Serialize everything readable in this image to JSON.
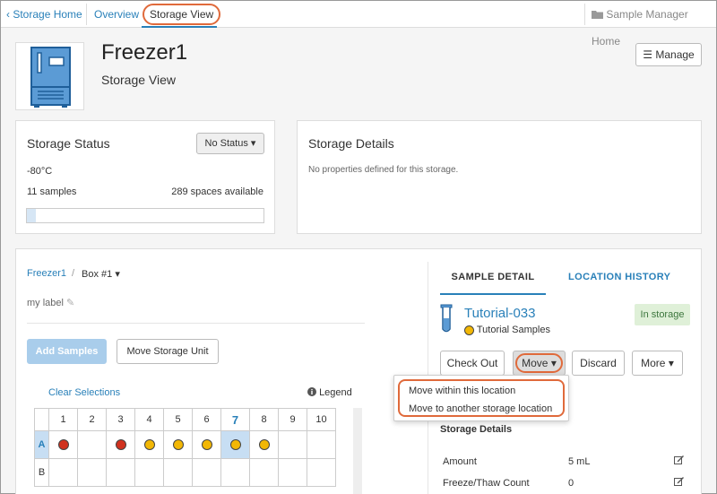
{
  "nav": {
    "home": "Storage Home",
    "overview": "Overview",
    "storage_view": "Storage View",
    "sample_manager_home": "Sample Manager Home"
  },
  "header": {
    "title": "Freezer1",
    "subtitle": "Storage View",
    "manage_label": "Manage"
  },
  "status_panel": {
    "title": "Storage Status",
    "status_button": "No Status",
    "temperature": "-80°C",
    "samples": "11 samples",
    "spaces": "289 spaces available",
    "fill_fraction": 0.037
  },
  "details_panel": {
    "title": "Storage Details",
    "empty_text": "No properties defined for this storage."
  },
  "grid": {
    "breadcrumb_root": "Freezer1",
    "breadcrumb_sep": "/",
    "breadcrumb_box": "Box #1",
    "label_text": "my label",
    "add_samples": "Add Samples",
    "move_unit": "Move Storage Unit",
    "clear_selections": "Clear Selections",
    "legend": "Legend",
    "columns": [
      "1",
      "2",
      "3",
      "4",
      "5",
      "6",
      "7",
      "8",
      "9",
      "10"
    ],
    "rows": [
      {
        "label": "A",
        "cells": [
          "red",
          "",
          "red",
          "yellow",
          "yellow",
          "yellow",
          "yellow",
          "yellow",
          "",
          ""
        ]
      },
      {
        "label": "B",
        "cells": [
          "",
          "",
          "",
          "",
          "",
          "",
          "",
          "",
          "",
          ""
        ]
      }
    ]
  },
  "detail": {
    "tab_detail": "SAMPLE DETAIL",
    "tab_history": "LOCATION HISTORY",
    "sample_name": "Tutorial-033",
    "sample_type": "Tutorial Samples",
    "badge": "In storage",
    "checkout": "Check Out",
    "move": "Move",
    "discard": "Discard",
    "more": "More",
    "menu": [
      "Move within this location",
      "Move to another storage location"
    ],
    "storage_details_heading": "Storage Details",
    "props": [
      {
        "label": "Amount",
        "value": "5 mL"
      },
      {
        "label": "Freeze/Thaw Count",
        "value": "0"
      }
    ]
  },
  "colors": {
    "accent": "#2980b9",
    "highlight": "#e06a3b",
    "dot_red": "#d0321f",
    "dot_yellow": "#f2b705",
    "selected": "#c7def3"
  }
}
